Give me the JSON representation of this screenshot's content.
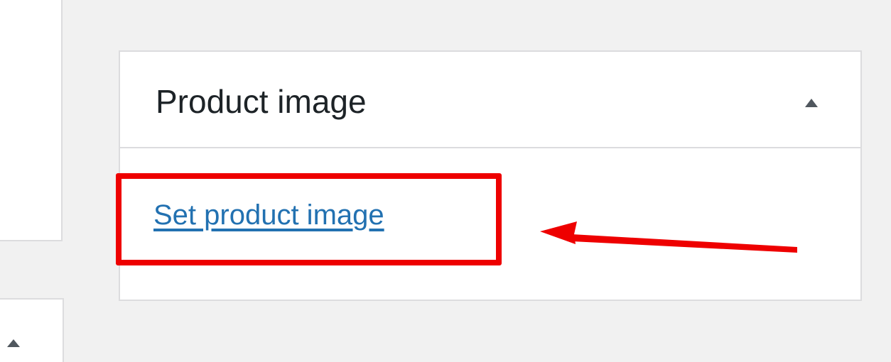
{
  "postbox": {
    "title": "Product image",
    "toggle_icon": "triangle-up-icon",
    "link_label": "Set product image"
  },
  "colors": {
    "background": "#f1f1f1",
    "panel": "#ffffff",
    "border": "#dcdcde",
    "title_text": "#1d2327",
    "link": "#2271b1",
    "annotation": "#ee0000"
  },
  "annotation": {
    "highlight_icon": "highlight-box",
    "arrow_icon": "arrow-left-icon"
  }
}
